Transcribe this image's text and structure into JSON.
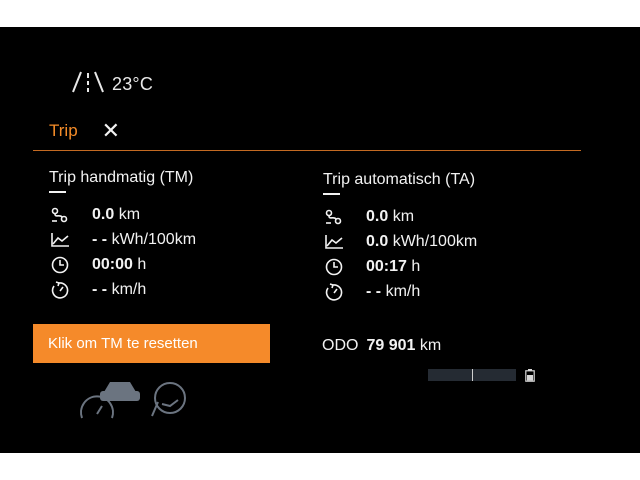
{
  "topbar": {
    "road_icon": "road-icon",
    "temperature": "23°C"
  },
  "panel": {
    "title": "Trip",
    "close_label": "✕",
    "trip_manual": {
      "title": "Trip handmatig (TM)",
      "distance": {
        "icon": "distance-icon",
        "value": "0.0",
        "unit": "km"
      },
      "consumption": {
        "icon": "consumption-graph-icon",
        "value": "- -",
        "unit": "kWh/100km"
      },
      "time": {
        "icon": "clock-icon",
        "value": "00:00",
        "unit": "h"
      },
      "speed": {
        "icon": "speedometer-icon",
        "value": "- -",
        "unit": "km/h"
      }
    },
    "trip_auto": {
      "title": "Trip automatisch (TA)",
      "distance": {
        "icon": "distance-icon",
        "value": "0.0",
        "unit": "km"
      },
      "consumption": {
        "icon": "consumption-graph-icon",
        "value": "0.0",
        "unit": "kWh/100km"
      },
      "time": {
        "icon": "clock-icon",
        "value": "00:17",
        "unit": "h"
      },
      "speed": {
        "icon": "speedometer-icon",
        "value": "- -",
        "unit": "km/h"
      }
    },
    "reset_button": "Klik om TM te resetten",
    "odo": {
      "label": "ODO",
      "value": "79 901",
      "unit": "km"
    }
  },
  "colors": {
    "accent": "#f58a2a",
    "background": "#000000",
    "text": "#f2f2f2"
  }
}
